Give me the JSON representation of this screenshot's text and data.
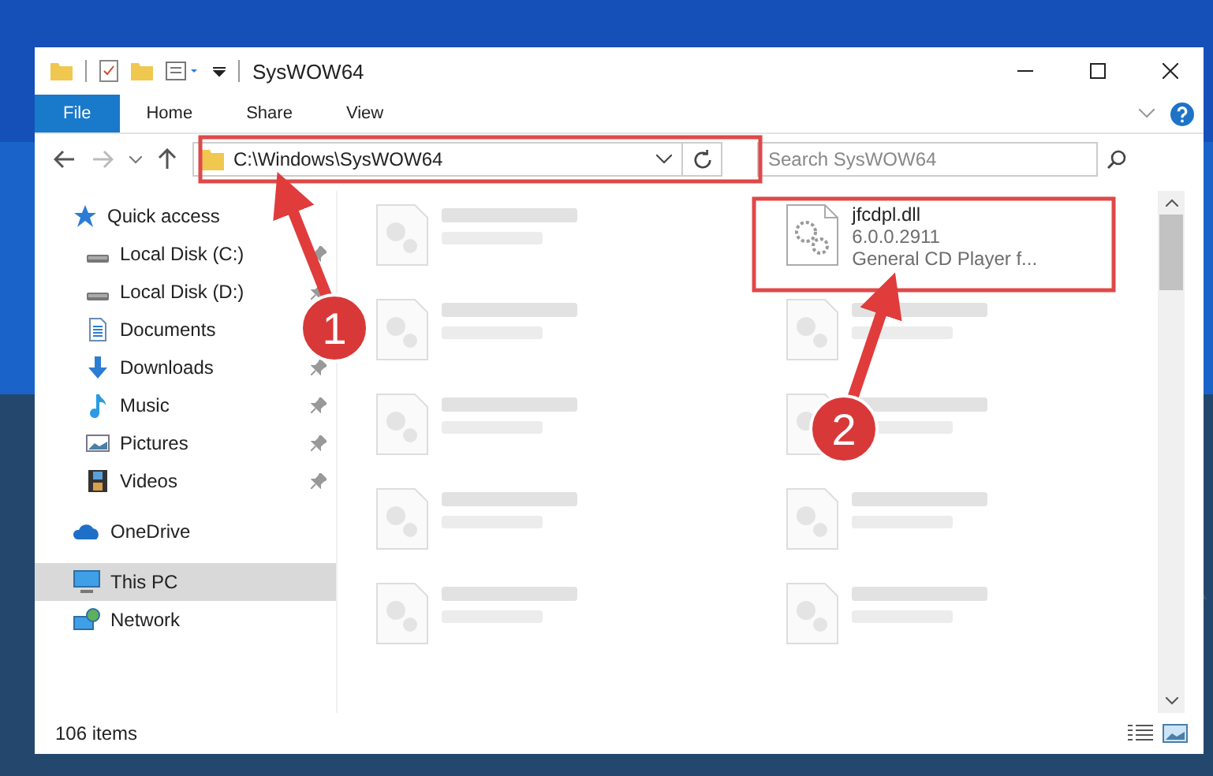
{
  "window": {
    "title": "SysWOW64"
  },
  "ribbon_tabs": [
    {
      "label": "File",
      "selected": true
    },
    {
      "label": "Home",
      "selected": false
    },
    {
      "label": "Share",
      "selected": false
    },
    {
      "label": "View",
      "selected": false
    }
  ],
  "address": {
    "path": "C:\\Windows\\SysWOW64"
  },
  "search": {
    "placeholder": "Search SysWOW64"
  },
  "sidebar": {
    "items": [
      {
        "label": "Quick access",
        "kind": "star",
        "selected": false,
        "children": [
          {
            "label": "Local Disk (C:)",
            "kind": "drive",
            "pinned": true
          },
          {
            "label": "Local Disk (D:)",
            "kind": "drive",
            "pinned": true
          },
          {
            "label": "Documents",
            "kind": "document"
          },
          {
            "label": "Downloads",
            "kind": "download",
            "pinned": true
          },
          {
            "label": "Music",
            "kind": "music",
            "pinned": true
          },
          {
            "label": "Pictures",
            "kind": "pictures",
            "pinned": true
          },
          {
            "label": "Videos",
            "kind": "videos",
            "pinned": true
          }
        ]
      },
      {
        "label": "OneDrive",
        "kind": "cloud",
        "selected": false
      },
      {
        "label": "This PC",
        "kind": "computer",
        "selected": true
      },
      {
        "label": "Network",
        "kind": "network",
        "selected": false
      }
    ]
  },
  "files": [
    {
      "kind": "blurred"
    },
    {
      "kind": "file",
      "name": "jfcdpl.dll",
      "lines": [
        "6.0.0.2911",
        "General CD Player f..."
      ]
    },
    {
      "kind": "blurred"
    },
    {
      "kind": "blurred"
    },
    {
      "kind": "blurred"
    },
    {
      "kind": "blurred"
    },
    {
      "kind": "blurred"
    },
    {
      "kind": "blurred"
    },
    {
      "kind": "blurred"
    },
    {
      "kind": "blurred"
    }
  ],
  "status_bar": {
    "count": "106 items"
  },
  "annotations": [
    {
      "number": "1"
    },
    {
      "number": "2"
    }
  ]
}
